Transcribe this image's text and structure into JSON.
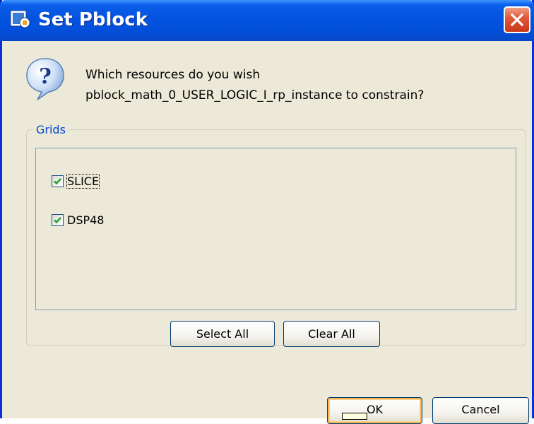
{
  "window": {
    "title": "Set Pblock",
    "app_icon": "app-window-icon",
    "close_icon": "close-icon"
  },
  "message": {
    "icon": "question-icon",
    "line1": "Which resources do you wish",
    "line2": "pblock_math_0_USER_LOGIC_I_rp_instance to constrain?"
  },
  "grids": {
    "legend": "Grids",
    "items": [
      {
        "label": "SLICE",
        "checked": true
      },
      {
        "label": "DSP48",
        "checked": true
      }
    ],
    "select_all_label": "Select All",
    "clear_all_label": "Clear All"
  },
  "buttons": {
    "ok_label": "OK",
    "cancel_label": "Cancel"
  },
  "colors": {
    "titlebar": "#0453e0",
    "window_bg": "#ece9d8",
    "legend_text": "#0046d5",
    "checkmark": "#21a121",
    "close_button": "#e2593a"
  }
}
